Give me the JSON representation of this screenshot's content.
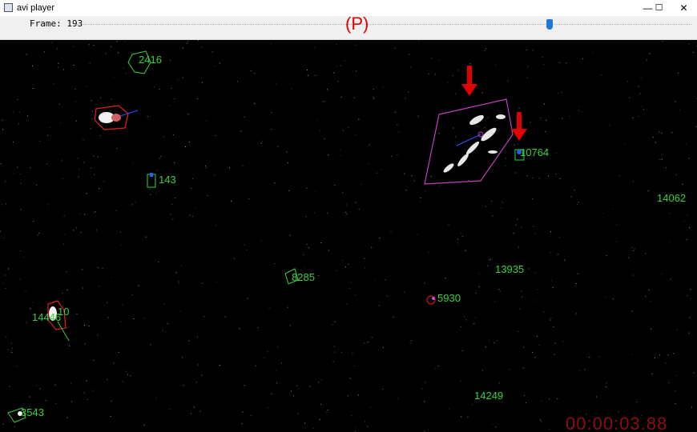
{
  "window": {
    "title": "avi player",
    "minimize_glyph": "—",
    "maximize_glyph": "☐",
    "close_glyph": "✕"
  },
  "toolbar": {
    "frame_label": "Frame: 193",
    "slider_fraction": 0.77
  },
  "video": {
    "status_overlay": "(P)",
    "timecode": "00:00:03.88",
    "track_labels": [
      "2416",
      "143",
      "10764",
      "14062",
      "13935",
      "8285",
      "5930",
      "10",
      "14446",
      "14249",
      "3543"
    ]
  },
  "colors": {
    "track_label": "#39d139",
    "highlight_arrow": "#e00000",
    "timecode": "#8a1010",
    "slider_thumb": "#1e78d8"
  }
}
